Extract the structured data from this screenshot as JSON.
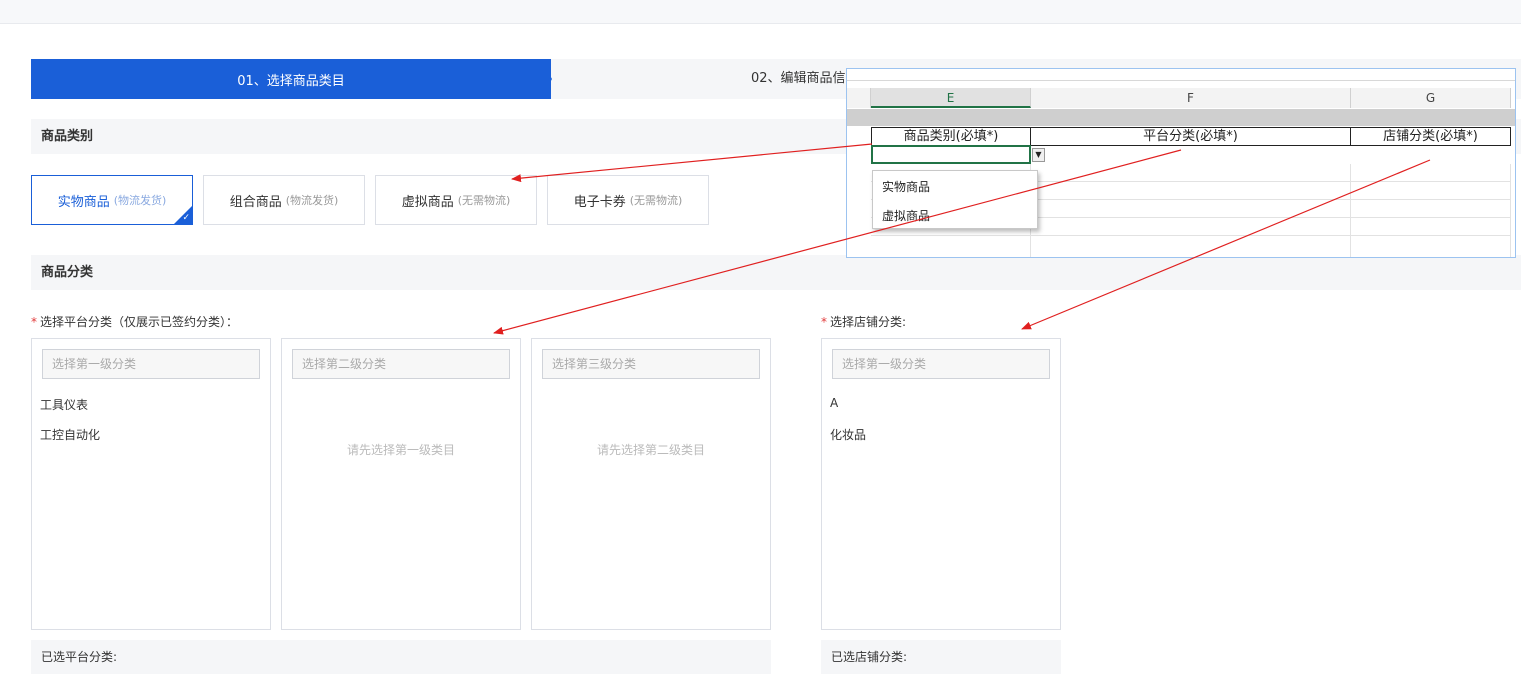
{
  "steps": {
    "step1": "01、选择商品类目",
    "step2": "02、编辑商品信"
  },
  "sections": {
    "category_type": "商品类别",
    "classification": "商品分类"
  },
  "category_cards": [
    {
      "name": "实物商品",
      "sub": "(物流发货)",
      "selected": true
    },
    {
      "name": "组合商品",
      "sub": "(物流发货)",
      "selected": false
    },
    {
      "name": "虚拟商品",
      "sub": "(无需物流)",
      "selected": false
    },
    {
      "name": "电子卡券",
      "sub": "(无需物流)",
      "selected": false
    }
  ],
  "platform": {
    "label": "选择平台分类（仅展示已签约分类）：",
    "level1_placeholder": "选择第一级分类",
    "level1_items": [
      "工具仪表",
      "工控自动化"
    ],
    "level2_placeholder": "选择第二级分类",
    "level2_hint": "请先选择第一级类目",
    "level3_placeholder": "选择第三级分类",
    "level3_hint": "请先选择第二级类目",
    "selected_label": "已选平台分类:"
  },
  "shop": {
    "label": "选择店铺分类:",
    "level1_placeholder": "选择第一级分类",
    "level1_items": [
      "A",
      "化妆品"
    ],
    "selected_label": "已选店铺分类:"
  },
  "required_mark": "*",
  "excel": {
    "columns": [
      "E",
      "F",
      "G"
    ],
    "headers": [
      "商品类别(必填*)",
      "平台分类(必填*)",
      "店铺分类(必填*)"
    ],
    "dropdown_options": [
      "实物商品",
      "虚拟商品"
    ],
    "dropdown_arrow": "▼"
  },
  "check_glyph": "✓",
  "colors": {
    "primary": "#1a5fd8",
    "annotation_arrow": "#e02020",
    "excel_green": "#217346"
  }
}
